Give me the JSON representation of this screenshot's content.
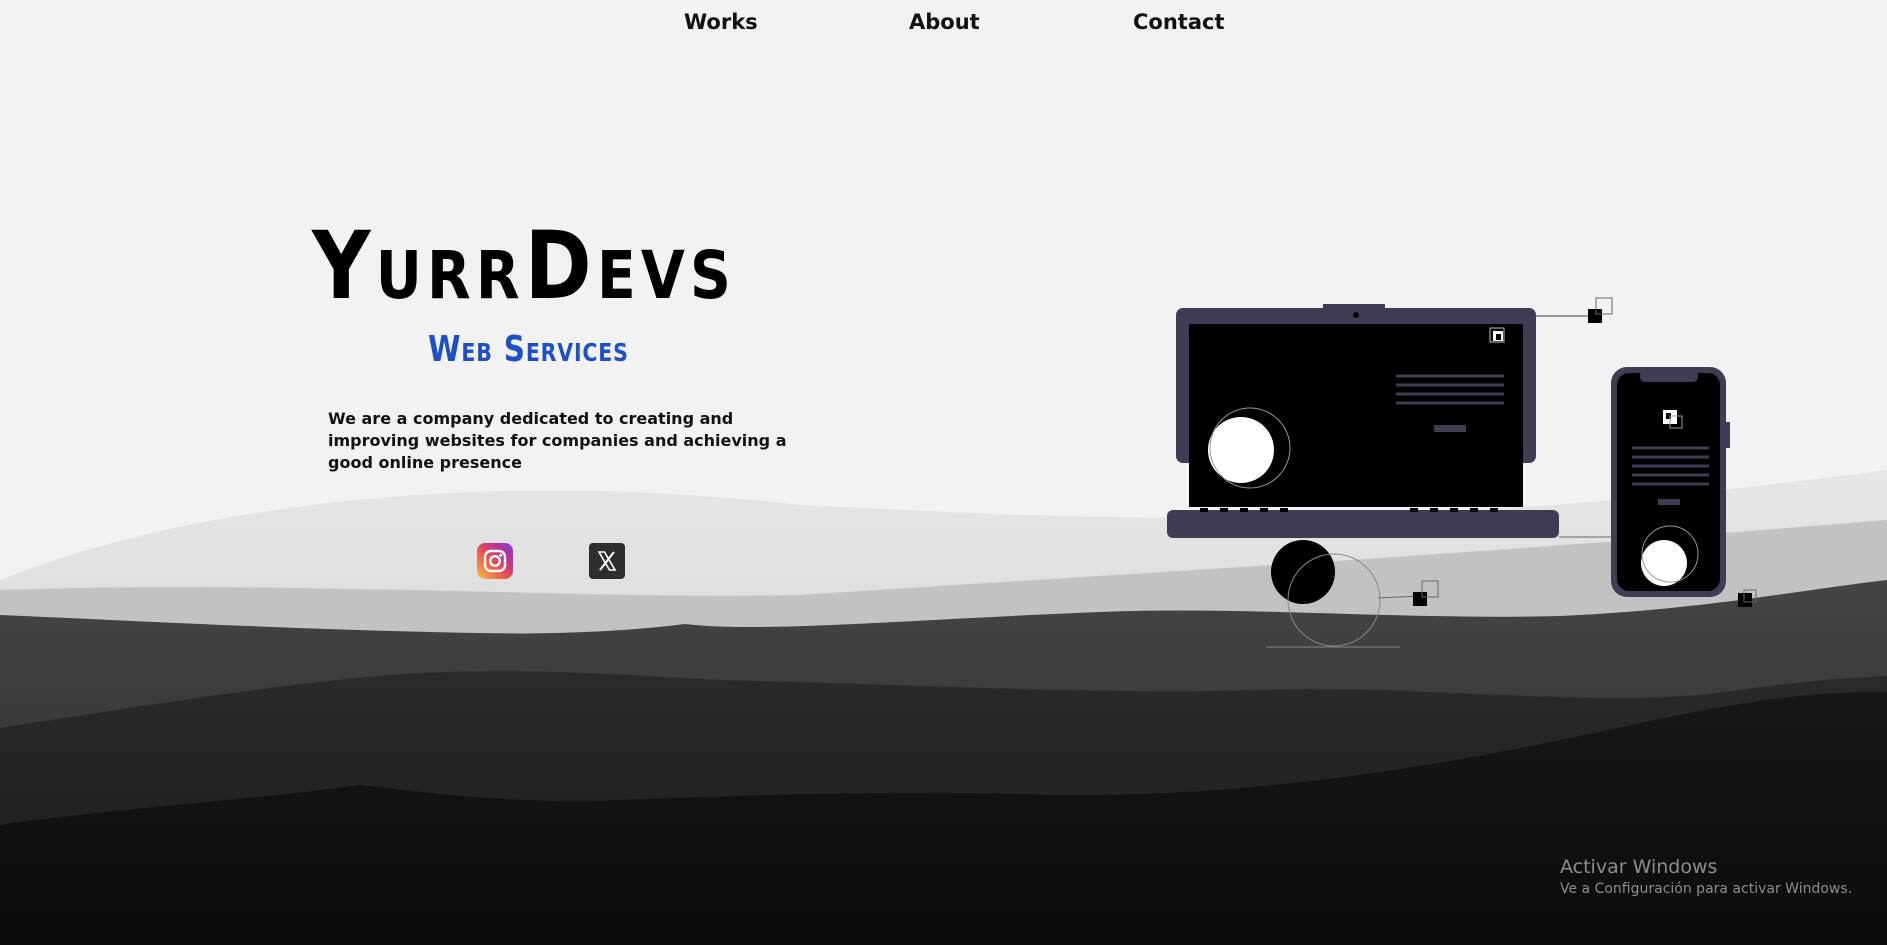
{
  "nav": {
    "items": [
      {
        "label": "Works"
      },
      {
        "label": "About"
      },
      {
        "label": "Contact"
      }
    ]
  },
  "hero": {
    "brand": "YurrDevs",
    "tagline": "Web Services",
    "description": "We are a company dedicated to creating and improving websites for companies and achieving a good online presence"
  },
  "social": {
    "icons": [
      "instagram-icon",
      "x-twitter-icon"
    ]
  },
  "colors": {
    "brand_text": "#000000",
    "tagline_blue": "#1d4fc7",
    "device_frame": "#3f3d56",
    "background": "#f2f2f2"
  },
  "os_watermark": {
    "title": "Activar Windows",
    "subtitle": "Ve a Configuración para activar Windows."
  }
}
